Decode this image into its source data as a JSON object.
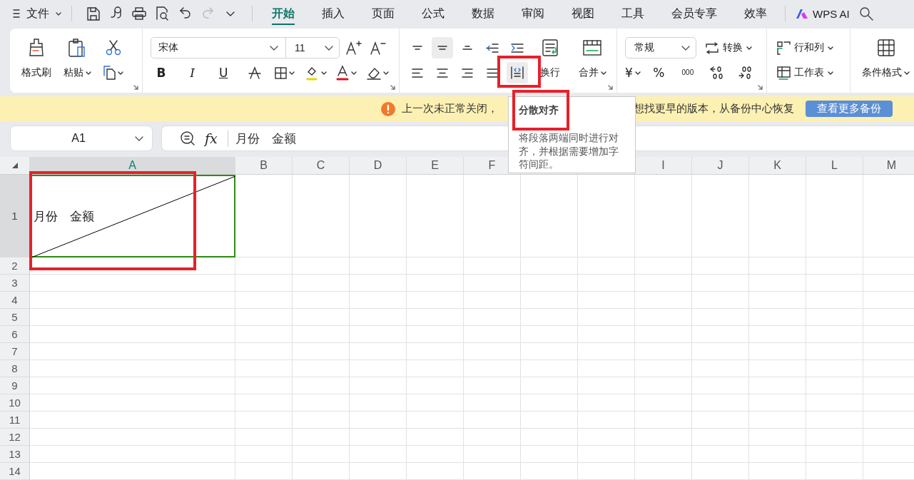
{
  "title_bar": {
    "file_menu": "文件",
    "quick_access": [
      {
        "kind": "save",
        "disabled": false
      },
      {
        "kind": "share",
        "disabled": false
      },
      {
        "kind": "print",
        "disabled": false
      },
      {
        "kind": "preview",
        "disabled": false
      },
      {
        "kind": "undo",
        "disabled": false
      },
      {
        "kind": "redo",
        "disabled": true
      },
      {
        "kind": "more",
        "disabled": false
      }
    ],
    "tabs": [
      {
        "label": "开始",
        "selected": true
      },
      {
        "label": "插入",
        "selected": false
      },
      {
        "label": "页面",
        "selected": false
      },
      {
        "label": "公式",
        "selected": false
      },
      {
        "label": "数据",
        "selected": false
      },
      {
        "label": "审阅",
        "selected": false
      },
      {
        "label": "视图",
        "selected": false
      },
      {
        "label": "工具",
        "selected": false
      },
      {
        "label": "会员专享",
        "selected": false
      },
      {
        "label": "效率",
        "selected": false
      }
    ],
    "ai_button": "WPS AI"
  },
  "ribbon": {
    "format_painter": "格式刷",
    "paste": "粘贴",
    "font_name": "宋体",
    "font_size": "11",
    "style_buttons": [
      "B",
      "I",
      "U"
    ],
    "align_buttons": [
      {
        "kind": "top",
        "selected": false
      },
      {
        "kind": "middle",
        "selected": true
      },
      {
        "kind": "bottom",
        "selected": false
      },
      {
        "kind": "outdent",
        "selected": false
      },
      {
        "kind": "indent",
        "selected": false
      },
      {
        "kind": "left",
        "selected": false
      },
      {
        "kind": "center",
        "selected": false
      },
      {
        "kind": "right",
        "selected": false
      },
      {
        "kind": "justify",
        "selected": false
      },
      {
        "kind": "distribute",
        "selected": true
      }
    ],
    "wrap": "换行",
    "merge": "合并",
    "number_format": "常规",
    "convert": "转换",
    "currency": "¥",
    "percent": "%",
    "thousands": "000",
    "rows_columns": "行和列",
    "worksheet": "工作表",
    "conditional_format": "条件格式"
  },
  "banner": {
    "text_start": "上一次未正常关闭，",
    "text_end": "想找更早的版本，从备份中心恢复",
    "button": "查看更多备份"
  },
  "tooltip": {
    "title": "分散对齐",
    "description": "将段落两端同时进行对齐，并根据需要增加字符间距。"
  },
  "formula_bar": {
    "name_box": "A1",
    "fx_label": "fx",
    "content": "月份　金额"
  },
  "sheet": {
    "columns": [
      {
        "label": "A",
        "selected": true
      },
      {
        "label": "B",
        "selected": false
      },
      {
        "label": "C",
        "selected": false
      },
      {
        "label": "D",
        "selected": false
      },
      {
        "label": "E",
        "selected": false
      },
      {
        "label": "F",
        "selected": false
      },
      {
        "selected": false
      },
      {
        "selected": false
      },
      {
        "label": "I",
        "selected": false
      },
      {
        "label": "J",
        "selected": false
      },
      {
        "label": "K",
        "selected": false
      },
      {
        "label": "L",
        "selected": false
      },
      {
        "label": "M",
        "selected": false
      }
    ],
    "rows": [
      {
        "label": "1",
        "selected": true
      },
      {
        "label": "2",
        "selected": false
      },
      {
        "label": "3",
        "selected": false
      },
      {
        "label": "4",
        "selected": false
      },
      {
        "label": "5",
        "selected": false
      },
      {
        "label": "6",
        "selected": false
      },
      {
        "label": "7",
        "selected": false
      },
      {
        "label": "8",
        "selected": false
      },
      {
        "label": "9",
        "selected": false
      },
      {
        "label": "10",
        "selected": false
      },
      {
        "label": "11",
        "selected": false
      },
      {
        "label": "12",
        "selected": false
      },
      {
        "label": "13",
        "selected": false
      },
      {
        "label": "14",
        "selected": false
      }
    ],
    "a1": {
      "text": "月份　金额",
      "diagonal": true
    }
  }
}
